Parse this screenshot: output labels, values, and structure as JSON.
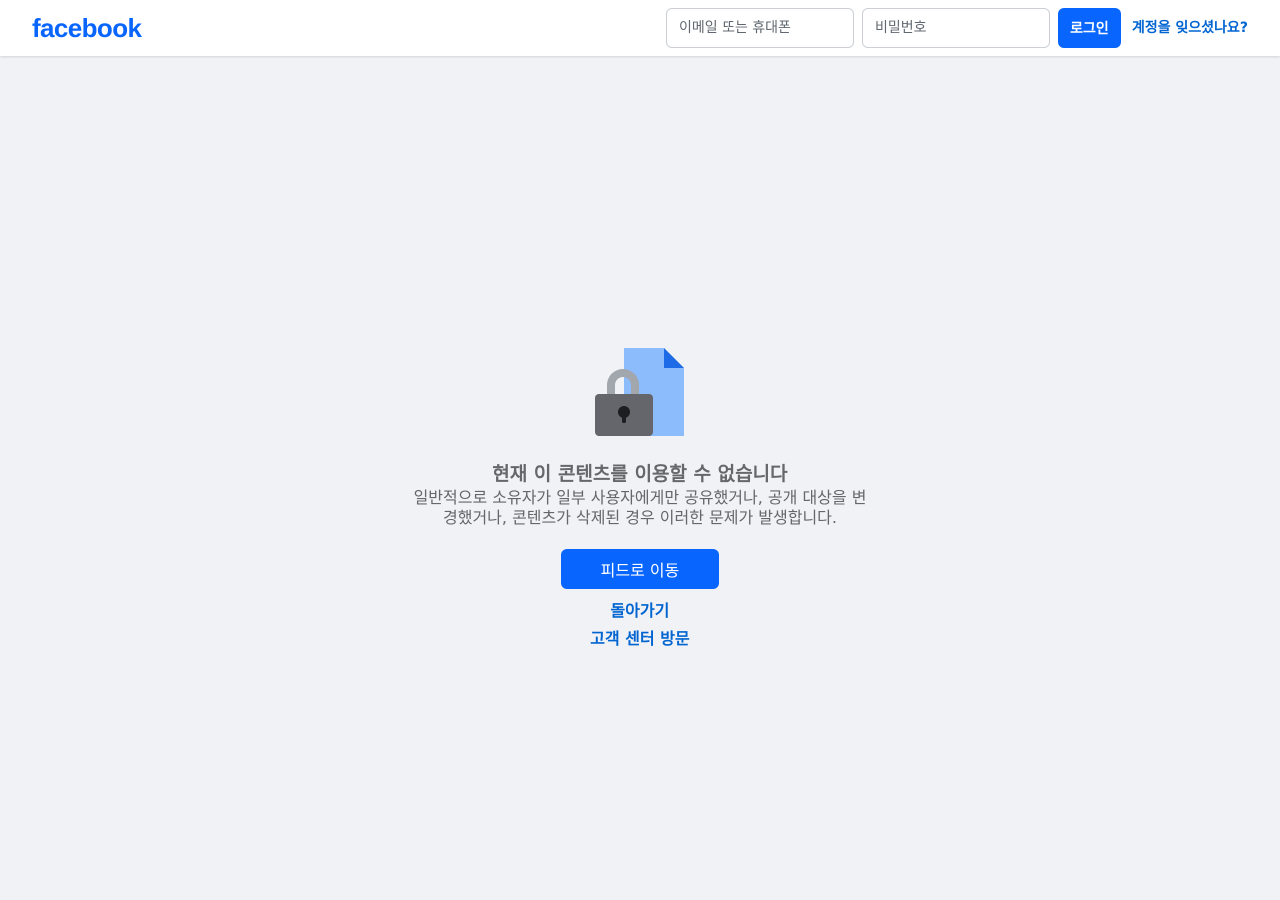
{
  "header": {
    "logo_text": "facebook",
    "email_placeholder": "이메일 또는 휴대폰",
    "password_placeholder": "비밀번호",
    "login_label": "로그인",
    "forgot_label": "계정을 잊으셨나요?"
  },
  "main": {
    "illustration": "locked-document-icon",
    "title": "현재 이 콘텐츠를 이용할 수 없습니다",
    "description": "일반적으로 소유자가 일부 사용자에게만 공유했거나, 공개 대상을 변경했거나, 콘텐츠가 삭제된 경우 이러한 문제가 발생합니다.",
    "feed_button_label": "피드로 이동",
    "back_link": "돌아가기",
    "help_link": "고객 센터 방문"
  },
  "colors": {
    "brand": "#0866ff",
    "link": "#0064d1",
    "background": "#f0f2f5",
    "muted_text": "#65676b"
  }
}
